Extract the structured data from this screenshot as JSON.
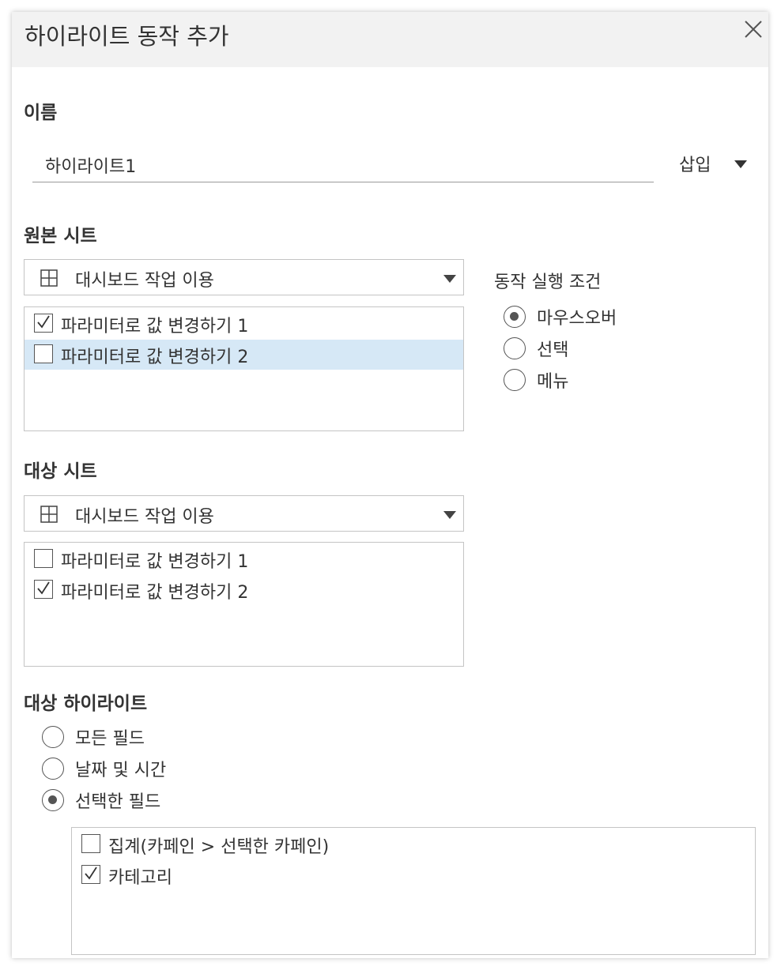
{
  "dialog": {
    "title": "하이라이트 동작 추가"
  },
  "name": {
    "label": "이름",
    "value": "하이라이트1",
    "insert_label": "삽입"
  },
  "source": {
    "label": "원본 시트",
    "dropdown_value": "대시보드 작업 이용",
    "items": [
      {
        "label": "파라미터로 값 변경하기 1",
        "checked": true
      },
      {
        "label": "파라미터로 값 변경하기 2",
        "checked": false,
        "selected": true
      }
    ]
  },
  "run_condition": {
    "label": "동작 실행 조건",
    "options": [
      {
        "label": "마우스오버",
        "selected": true
      },
      {
        "label": "선택",
        "selected": false
      },
      {
        "label": "메뉴",
        "selected": false
      }
    ]
  },
  "target": {
    "label": "대상 시트",
    "dropdown_value": "대시보드 작업 이용",
    "items": [
      {
        "label": "파라미터로 값 변경하기 1",
        "checked": false
      },
      {
        "label": "파라미터로 값 변경하기 2",
        "checked": true
      }
    ]
  },
  "target_highlight": {
    "label": "대상 하이라이트",
    "options": [
      {
        "label": "모든 필드",
        "selected": false
      },
      {
        "label": "날짜 및 시간",
        "selected": false
      },
      {
        "label": "선택한 필드",
        "selected": true
      }
    ],
    "fields": [
      {
        "label": "집계(카페인 > 선택한 카페인)",
        "checked": false
      },
      {
        "label": "카테고리",
        "checked": true
      }
    ]
  }
}
